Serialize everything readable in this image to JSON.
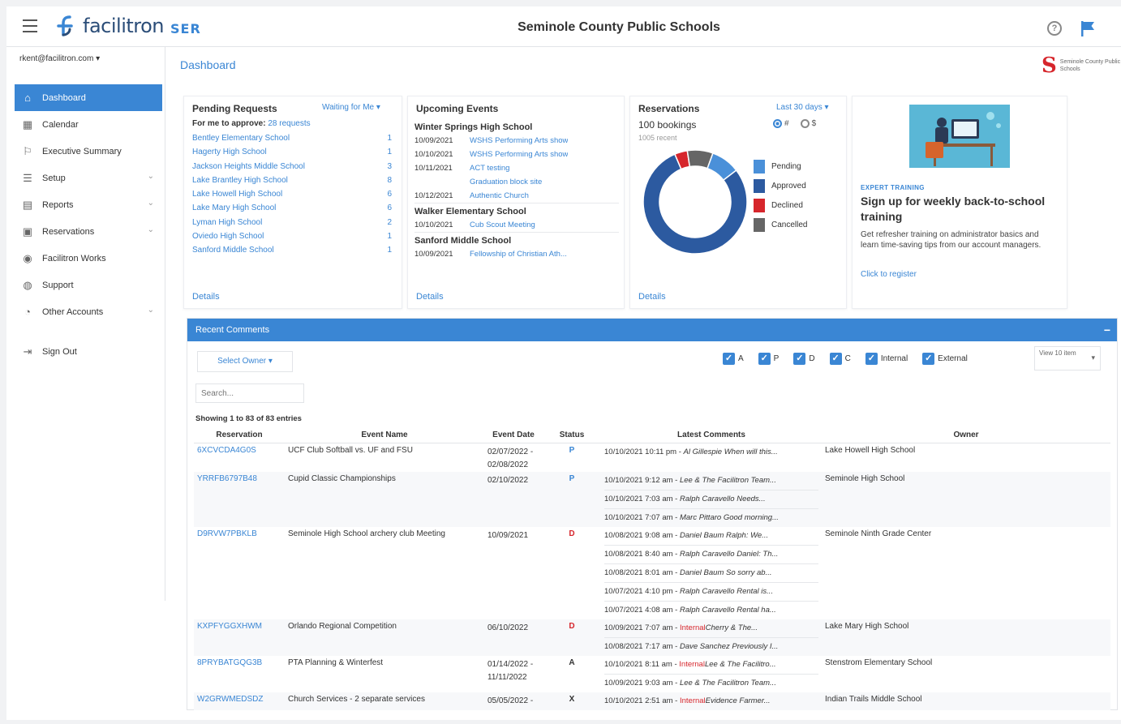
{
  "header": {
    "brand": "facilitron",
    "brand_sub": "SER",
    "org_title": "Seminole County Public Schools"
  },
  "sidebar": {
    "user_email": "rkent@facilitron.com",
    "items": [
      {
        "label": "Dashboard",
        "icon": "home-icon",
        "active": true
      },
      {
        "label": "Calendar",
        "icon": "calendar-icon"
      },
      {
        "label": "Executive Summary",
        "icon": "summary-icon"
      },
      {
        "label": "Setup",
        "icon": "setup-icon",
        "has_chevron": true
      },
      {
        "label": "Reports",
        "icon": "reports-icon",
        "has_chevron": true
      },
      {
        "label": "Reservations",
        "icon": "reservations-icon",
        "has_chevron": true
      },
      {
        "label": "Facilitron Works",
        "icon": "works-icon"
      },
      {
        "label": "Support",
        "icon": "support-icon"
      },
      {
        "label": "Other Accounts",
        "icon": "accounts-icon",
        "has_chevron": true
      }
    ],
    "signout": "Sign Out"
  },
  "main": {
    "breadcrumb": "Dashboard",
    "district_logo_text": "Seminole County Public Schools"
  },
  "pending": {
    "title": "Pending Requests",
    "filter": "Waiting for Me",
    "subtitle_prefix": "For me to approve:",
    "subtitle_count": "28 requests",
    "items": [
      {
        "name": "Bentley Elementary School",
        "count": "1"
      },
      {
        "name": "Hagerty High School",
        "count": "1"
      },
      {
        "name": "Jackson Heights Middle School",
        "count": "3"
      },
      {
        "name": "Lake Brantley High School",
        "count": "8"
      },
      {
        "name": "Lake Howell High School",
        "count": "6"
      },
      {
        "name": "Lake Mary High School",
        "count": "6"
      },
      {
        "name": "Lyman High School",
        "count": "2"
      },
      {
        "name": "Oviedo High School",
        "count": "1"
      },
      {
        "name": "Sanford Middle School",
        "count": "1"
      }
    ],
    "details": "Details"
  },
  "upcoming": {
    "title": "Upcoming Events",
    "groups": [
      {
        "school": "Winter Springs High School",
        "events": [
          {
            "date": "10/09/2021",
            "name": "WSHS Performing Arts show"
          },
          {
            "date": "10/10/2021",
            "name": "WSHS Performing Arts show"
          },
          {
            "date": "10/11/2021",
            "name": "ACT testing"
          },
          {
            "date": "",
            "name": "Graduation block site"
          },
          {
            "date": "10/12/2021",
            "name": "Authentic Church"
          }
        ]
      },
      {
        "school": "Walker Elementary School",
        "events": [
          {
            "date": "10/10/2021",
            "name": "Cub Scout Meeting"
          }
        ]
      },
      {
        "school": "Sanford Middle School",
        "events": [
          {
            "date": "10/09/2021",
            "name": "Fellowship of Christian Ath..."
          }
        ]
      }
    ],
    "details": "Details"
  },
  "reservations": {
    "title": "Reservations",
    "filter": "Last 30 days",
    "count_label": "100 bookings",
    "sub_label": "1005 recent",
    "radio_a": "#",
    "radio_b": "$",
    "legend": [
      {
        "label": "Pending",
        "color": "#4a90d9"
      },
      {
        "label": "Approved",
        "color": "#2c5aa0"
      },
      {
        "label": "Declined",
        "color": "#d6262c"
      },
      {
        "label": "Cancelled",
        "color": "#666666"
      }
    ],
    "details": "Details"
  },
  "chart_data": {
    "type": "pie",
    "categories": [
      "Pending",
      "Approved",
      "Declined",
      "Cancelled"
    ],
    "values": [
      9,
      79,
      4,
      8
    ]
  },
  "promo": {
    "tag": "EXPERT TRAINING",
    "title": "Sign up for weekly back-to-school training",
    "text": "Get refresher training on administrator basics and learn time-saving tips from our account managers.",
    "link": "Click to register"
  },
  "recent": {
    "title": "Recent Comments",
    "owner_select": "Select Owner",
    "checkboxes": [
      "A",
      "P",
      "D",
      "C",
      "Internal",
      "External"
    ],
    "view_select": "View 10 item",
    "search_placeholder": "Search...",
    "showing": "Showing 1 to 83 of 83 entries",
    "columns": [
      "Reservation",
      "Event Name",
      "Event Date",
      "Status",
      "Latest Comments",
      "Owner"
    ],
    "rows": [
      {
        "res": "6XCVCDA4G0S",
        "event": "UCF Club Softball vs. UF and FSU",
        "dates": [
          "02/07/2022 -",
          "02/08/2022"
        ],
        "status": "P",
        "comments": [
          {
            "ts": "10/10/2021 10:11 pm",
            "internal": false,
            "who": "Al Gillespie",
            "text": "When will this..."
          }
        ],
        "owner": "Lake Howell High School"
      },
      {
        "res": "YRRFB6797B48",
        "event": "Cupid Classic Championships",
        "dates": [
          "02/10/2022"
        ],
        "status": "P",
        "comments": [
          {
            "ts": "10/10/2021 9:12 am",
            "internal": false,
            "who": "Lee &",
            "text": "The Facilitron Team..."
          },
          {
            "ts": "10/10/2021 7:03 am",
            "internal": false,
            "who": "Ralph Caravello",
            "text": "Needs..."
          },
          {
            "ts": "10/10/2021 7:07 am",
            "internal": false,
            "who": "Marc Pittaro",
            "text": "Good morning..."
          }
        ],
        "owner": "Seminole High School"
      },
      {
        "res": "D9RVW7PBKLB",
        "event": "Seminole High School archery club Meeting",
        "dates": [
          "10/09/2021"
        ],
        "status": "D",
        "comments": [
          {
            "ts": "10/08/2021 9:08 am",
            "internal": false,
            "who": "Daniel Baum",
            "text": "Ralph: We..."
          },
          {
            "ts": "10/08/2021 8:40 am",
            "internal": false,
            "who": "Ralph Caravello",
            "text": "Daniel: Th..."
          },
          {
            "ts": "10/08/2021 8:01 am",
            "internal": false,
            "who": "Daniel Baum",
            "text": "So sorry ab..."
          },
          {
            "ts": "10/07/2021 4:10 pm",
            "internal": false,
            "who": "Ralph Caravello",
            "text": "Rental is..."
          },
          {
            "ts": "10/07/2021 4:08 am",
            "internal": false,
            "who": "Ralph Caravello",
            "text": "Rental ha..."
          }
        ],
        "owner": "Seminole Ninth Grade Center"
      },
      {
        "res": "KXPFYGGXHWM",
        "event": "Orlando Regional Competition",
        "dates": [
          "06/10/2022"
        ],
        "status": "D",
        "comments": [
          {
            "ts": "10/09/2021 7:07 am",
            "internal": true,
            "who": "Cherry &",
            "text": "The..."
          },
          {
            "ts": "10/08/2021 7:17 am",
            "internal": false,
            "who": "Dave Sanchez",
            "text": "Previously I..."
          }
        ],
        "owner": "Lake Mary High School"
      },
      {
        "res": "8PRYBATGQG3B",
        "event": "PTA Planning & Winterfest",
        "dates": [
          "01/14/2022 -",
          "11/11/2022"
        ],
        "status": "A",
        "comments": [
          {
            "ts": "10/10/2021 8:11 am",
            "internal": true,
            "who": "Lee & The",
            "text": "Facilitro..."
          },
          {
            "ts": "10/09/2021 9:03 am",
            "internal": false,
            "who": "Lee &",
            "text": "The Facilitron Team..."
          }
        ],
        "owner": "Stenstrom Elementary School"
      },
      {
        "res": "W2GRWMEDSDZ",
        "event": "Church Services - 2 separate services",
        "dates": [
          "05/05/2022 -"
        ],
        "status": "X",
        "comments": [
          {
            "ts": "10/10/2021 2:51 am",
            "internal": true,
            "who": "Evidence",
            "text": "Farmer..."
          }
        ],
        "owner": "Indian Trails Middle School"
      }
    ]
  }
}
